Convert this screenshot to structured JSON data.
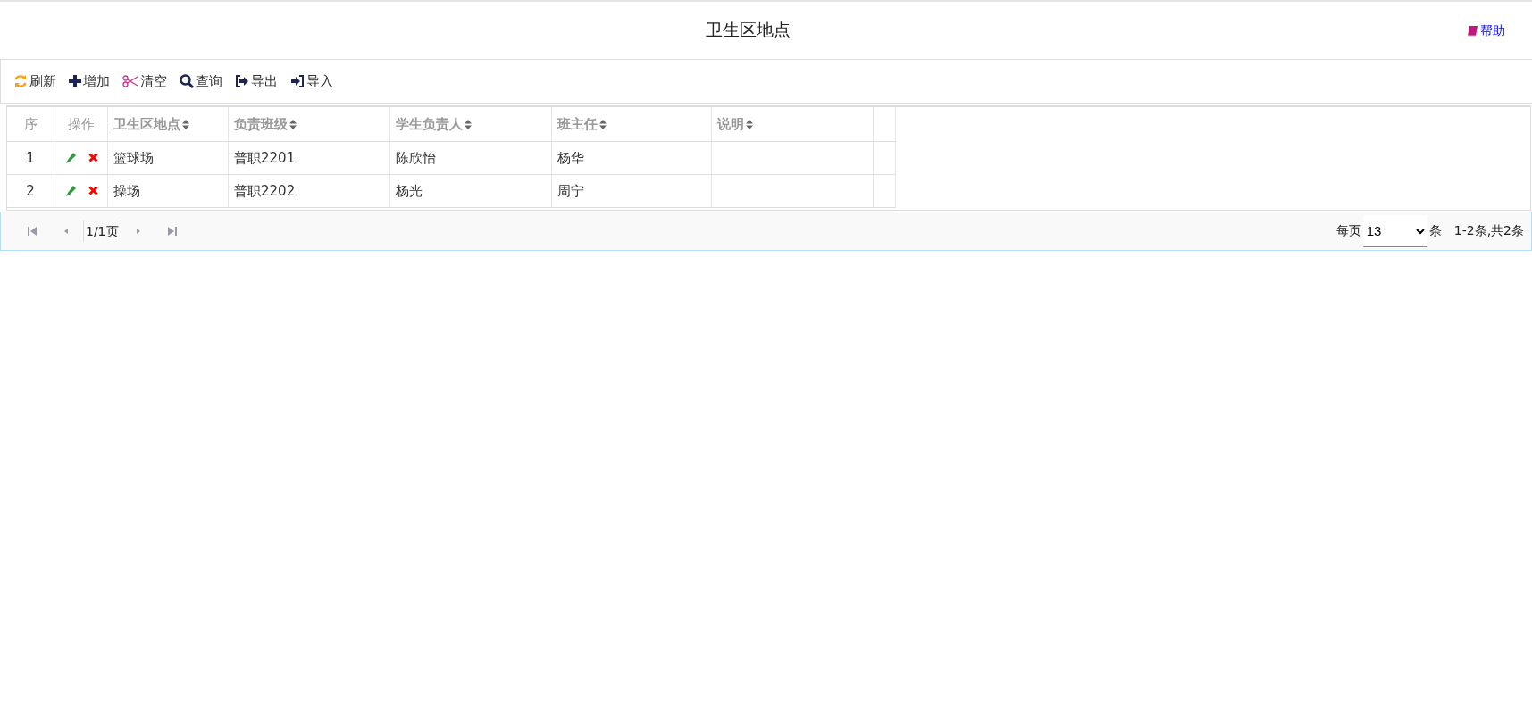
{
  "header": {
    "title": "卫生区地点",
    "help": "帮助"
  },
  "toolbar": [
    {
      "kind": "refresh",
      "label": "刷新"
    },
    {
      "kind": "add",
      "label": "增加"
    },
    {
      "kind": "clear",
      "label": "清空"
    },
    {
      "kind": "search",
      "label": "查询"
    },
    {
      "kind": "export",
      "label": "导出"
    },
    {
      "kind": "import",
      "label": "导入"
    }
  ],
  "table": {
    "columns": [
      {
        "label": "序",
        "sortable": false
      },
      {
        "label": "操作",
        "sortable": false
      },
      {
        "label": "卫生区地点",
        "sortable": true
      },
      {
        "label": "负责班级",
        "sortable": true
      },
      {
        "label": "学生负责人",
        "sortable": true
      },
      {
        "label": "班主任",
        "sortable": true
      },
      {
        "label": "说明",
        "sortable": true
      }
    ],
    "rows": [
      {
        "cells": [
          "1",
          "",
          "篮球场",
          "普职2201",
          "陈欣怡",
          "杨华",
          ""
        ]
      },
      {
        "cells": [
          "2",
          "",
          "操场",
          "普职2202",
          "杨光",
          "周宁",
          ""
        ]
      }
    ]
  },
  "pager": {
    "page": "1/1页",
    "per_page_label": "每页",
    "page_size": "13",
    "unit": "条",
    "summary": "1-2条,共2条"
  }
}
